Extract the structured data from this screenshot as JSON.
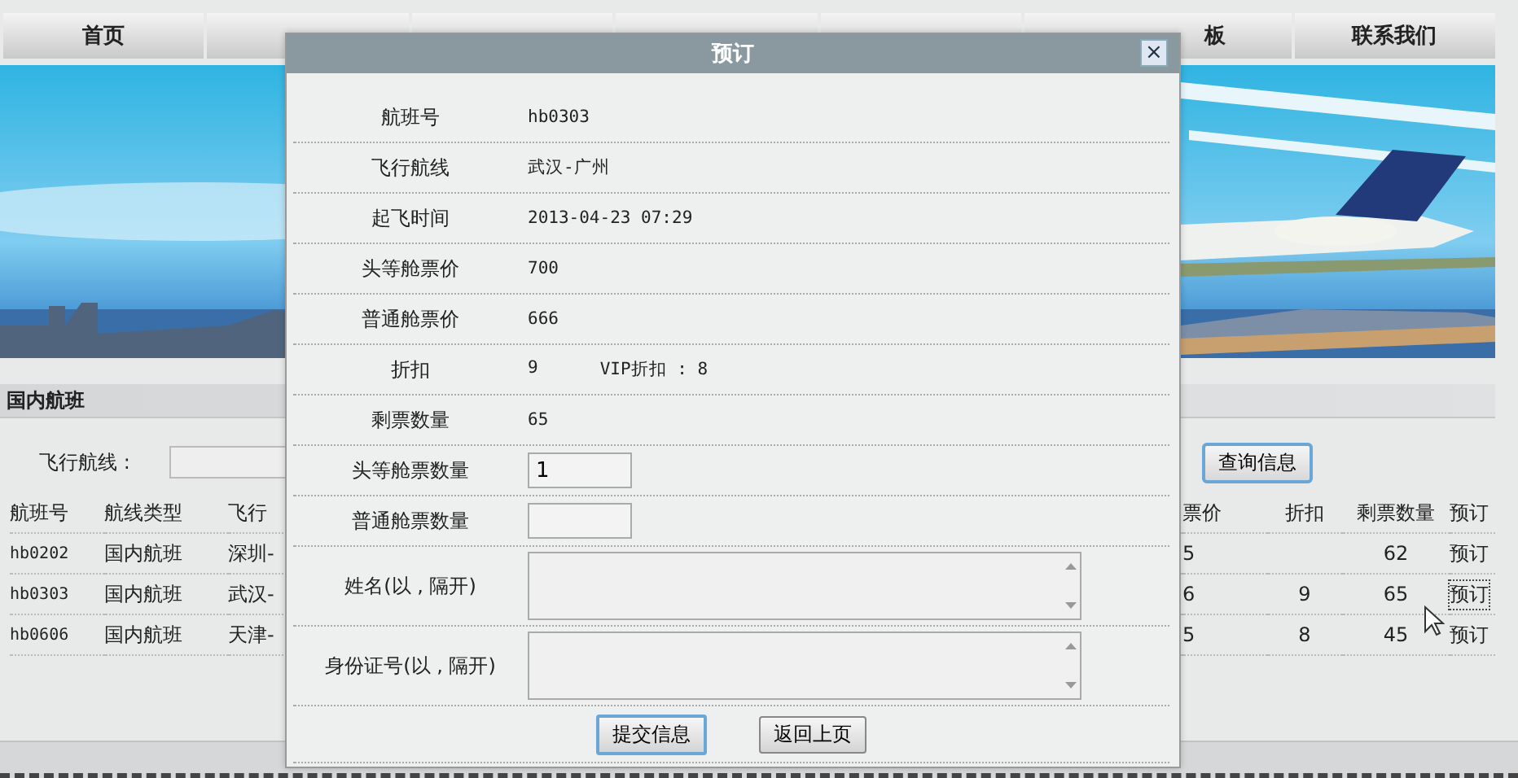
{
  "nav": [
    {
      "kind": "tab",
      "label": "首页"
    },
    {
      "kind": "covered"
    },
    {
      "kind": "covered"
    },
    {
      "kind": "covered"
    },
    {
      "kind": "covered"
    },
    {
      "kind": "partial",
      "label": "板"
    },
    {
      "kind": "tab",
      "label": "联系我们"
    }
  ],
  "flights": {
    "title": "国内航班",
    "search": {
      "label": "飞行航线 :",
      "button": "查询信息"
    },
    "columns_left": [
      "航班号",
      "航线类型",
      "飞行"
    ],
    "columns_right": [
      "票价",
      "折扣",
      "剩票数量",
      "预订"
    ],
    "rows": [
      {
        "flight": "hb0202",
        "type": "国内航班",
        "route": "深圳-",
        "price": "5",
        "remaining": "62",
        "action": "预订",
        "focused": false
      },
      {
        "flight": "hb0303",
        "type": "国内航班",
        "route": "武汉-",
        "price": "6",
        "discount": "9",
        "remaining": "65",
        "action": "预订",
        "focused": true
      },
      {
        "flight": "hb0606",
        "type": "国内航班",
        "route": "天津-",
        "price": "5",
        "discount": "8",
        "remaining": "45",
        "action": "预订",
        "focused": false
      }
    ]
  },
  "booking_dialog": {
    "title": "预订",
    "close": "×",
    "rows": [
      {
        "kind": "text",
        "label": "航班号",
        "value": "hb0303"
      },
      {
        "kind": "text",
        "label": "飞行航线",
        "value": "武汉-广州"
      },
      {
        "kind": "text",
        "label": "起飞时间",
        "value": "2013-04-23 07:29"
      },
      {
        "kind": "text",
        "label": "头等舱票价",
        "value": "700"
      },
      {
        "kind": "text",
        "label": "普通舱票价",
        "value": "666"
      },
      {
        "kind": "pair",
        "label": "折扣",
        "value": "9",
        "extra": "VIP折扣 : 8"
      },
      {
        "kind": "text",
        "label": "剩票数量",
        "value": "65"
      },
      {
        "kind": "input",
        "label": "头等舱票数量",
        "value": "1"
      },
      {
        "kind": "input",
        "label": "普通舱票数量"
      },
      {
        "kind": "textarea",
        "label": "姓名(以 , 隔开)"
      },
      {
        "kind": "textarea",
        "label": "身份证号(以 , 隔开)"
      }
    ],
    "buttons": [
      {
        "label": "提交信息",
        "focused": true
      },
      {
        "label": "返回上页",
        "focused": false
      }
    ]
  }
}
